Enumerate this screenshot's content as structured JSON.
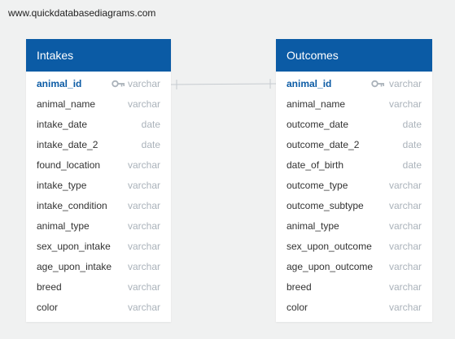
{
  "watermark": "www.quickdatabasediagrams.com",
  "colors": {
    "header": "#0b5ba5",
    "type_text": "#aab2ba",
    "background": "#f0f1f1"
  },
  "tables": [
    {
      "name": "Intakes",
      "fields": [
        {
          "name": "animal_id",
          "type": "varchar",
          "pk": true
        },
        {
          "name": "animal_name",
          "type": "varchar"
        },
        {
          "name": "intake_date",
          "type": "date"
        },
        {
          "name": "intake_date_2",
          "type": "date"
        },
        {
          "name": "found_location",
          "type": "varchar"
        },
        {
          "name": "intake_type",
          "type": "varchar"
        },
        {
          "name": "intake_condition",
          "type": "varchar"
        },
        {
          "name": "animal_type",
          "type": "varchar"
        },
        {
          "name": "sex_upon_intake",
          "type": "varchar"
        },
        {
          "name": "age_upon_intake",
          "type": "varchar"
        },
        {
          "name": "breed",
          "type": "varchar"
        },
        {
          "name": "color",
          "type": "varchar"
        }
      ]
    },
    {
      "name": "Outcomes",
      "fields": [
        {
          "name": "animal_id",
          "type": "varchar",
          "pk": true
        },
        {
          "name": "animal_name",
          "type": "varchar"
        },
        {
          "name": "outcome_date",
          "type": "date"
        },
        {
          "name": "outcome_date_2",
          "type": "date"
        },
        {
          "name": "date_of_birth",
          "type": "date"
        },
        {
          "name": "outcome_type",
          "type": "varchar"
        },
        {
          "name": "outcome_subtype",
          "type": "varchar"
        },
        {
          "name": "animal_type",
          "type": "varchar"
        },
        {
          "name": "sex_upon_outcome",
          "type": "varchar"
        },
        {
          "name": "age_upon_outcome",
          "type": "varchar"
        },
        {
          "name": "breed",
          "type": "varchar"
        },
        {
          "name": "color",
          "type": "varchar"
        }
      ]
    }
  ],
  "relationship": {
    "from": "Intakes.animal_id",
    "to": "Outcomes.animal_id",
    "type": "one-to-one"
  }
}
